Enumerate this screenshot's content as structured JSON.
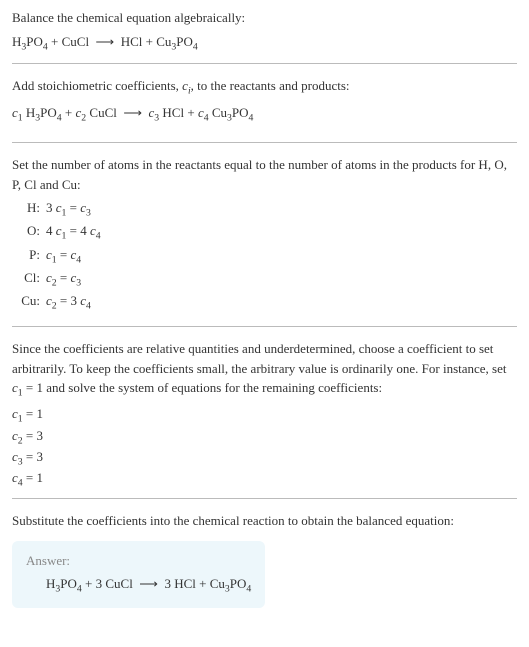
{
  "title": "Balance the chemical equation algebraically:",
  "initial_equation": "H<sub>3</sub>PO<sub>4</sub> + CuCl &nbsp;⟶&nbsp; HCl + Cu<sub>3</sub>PO<sub>4</sub>",
  "stoich_text": "Add stoichiometric coefficients, <span class='ital'>c<sub>i</sub></span>, to the reactants and products:",
  "stoich_equation": "<span class='ital'>c</span><sub>1</sub> H<sub>3</sub>PO<sub>4</sub> + <span class='ital'>c</span><sub>2</sub> CuCl &nbsp;⟶&nbsp; <span class='ital'>c</span><sub>3</sub> HCl + <span class='ital'>c</span><sub>4</sub> Cu<sub>3</sub>PO<sub>4</sub>",
  "atoms_text": "Set the number of atoms in the reactants equal to the number of atoms in the products for H, O, P, Cl and Cu:",
  "atom_equations": [
    {
      "label": "H:",
      "eq": "3 <span class='ital'>c</span><sub>1</sub> = <span class='ital'>c</span><sub>3</sub>"
    },
    {
      "label": "O:",
      "eq": "4 <span class='ital'>c</span><sub>1</sub> = 4 <span class='ital'>c</span><sub>4</sub>"
    },
    {
      "label": "P:",
      "eq": "<span class='ital'>c</span><sub>1</sub> = <span class='ital'>c</span><sub>4</sub>"
    },
    {
      "label": "Cl:",
      "eq": "<span class='ital'>c</span><sub>2</sub> = <span class='ital'>c</span><sub>3</sub>"
    },
    {
      "label": "Cu:",
      "eq": "<span class='ital'>c</span><sub>2</sub> = 3 <span class='ital'>c</span><sub>4</sub>"
    }
  ],
  "solve_text": "Since the coefficients are relative quantities and underdetermined, choose a coefficient to set arbitrarily. To keep the coefficients small, the arbitrary value is ordinarily one. For instance, set <span class='ital'>c</span><sub>1</sub> = 1 and solve the system of equations for the remaining coefficients:",
  "coefficients": [
    "<span class='ital'>c</span><sub>1</sub> = 1",
    "<span class='ital'>c</span><sub>2</sub> = 3",
    "<span class='ital'>c</span><sub>3</sub> = 3",
    "<span class='ital'>c</span><sub>4</sub> = 1"
  ],
  "final_text": "Substitute the coefficients into the chemical reaction to obtain the balanced equation:",
  "answer_label": "Answer:",
  "answer_equation": "H<sub>3</sub>PO<sub>4</sub> + 3 CuCl &nbsp;⟶&nbsp; 3 HCl + Cu<sub>3</sub>PO<sub>4</sub>"
}
